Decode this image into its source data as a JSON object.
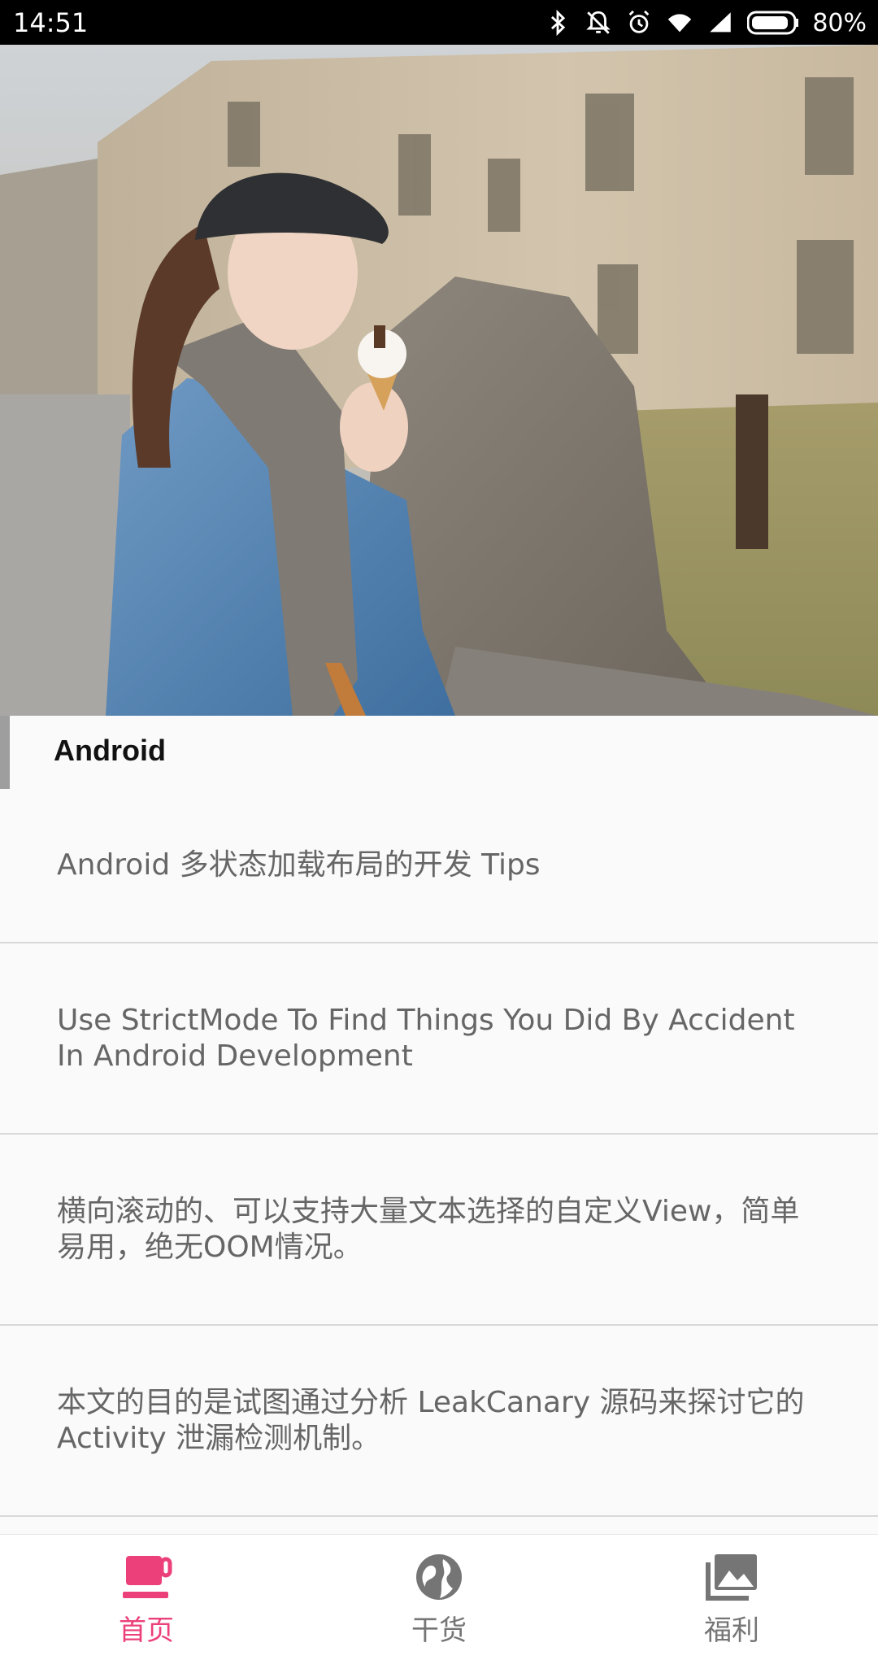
{
  "status_bar": {
    "time": "14:51",
    "battery": "80%",
    "icons": [
      "bluetooth-icon",
      "mute-icon",
      "alarm-icon",
      "wifi-icon",
      "signal-icon",
      "battery-icon"
    ]
  },
  "hero": {
    "image": "photo-girl-ice-cream"
  },
  "section": {
    "title": "Android"
  },
  "list": {
    "items": [
      {
        "title": "Android 多状态加载布局的开发 Tips"
      },
      {
        "title": "Use StrictMode To Find Things You Did By Accident In Android Development"
      },
      {
        "title": "横向滚动的、可以支持大量文本选择的自定义View，简单易用，绝无OOM情况。"
      },
      {
        "title": "本文的目的是试图通过分析 LeakCanary 源码来探讨它的 Activity 泄漏检测机制。"
      }
    ]
  },
  "bottom_nav": {
    "items": [
      {
        "label": "首页",
        "icon": "cup-icon",
        "active": true
      },
      {
        "label": "干货",
        "icon": "globe-icon",
        "active": false
      },
      {
        "label": "福利",
        "icon": "gallery-icon",
        "active": false
      }
    ]
  },
  "colors": {
    "accent": "#ec407a",
    "inactive": "#757575",
    "status_bar": "#000000"
  }
}
